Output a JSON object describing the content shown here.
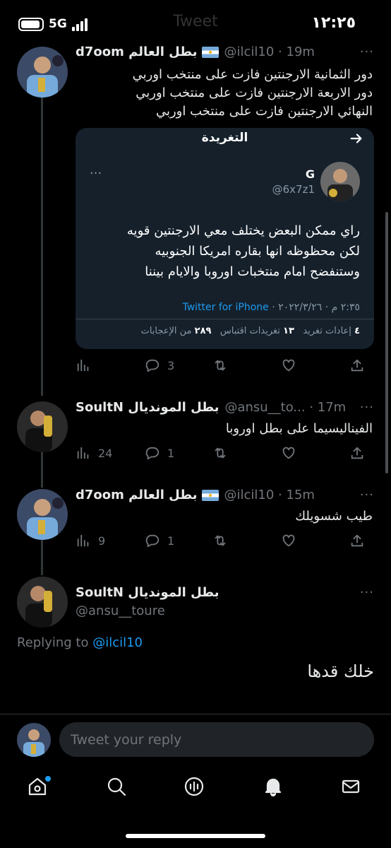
{
  "status_bar": {
    "time": "١٢:٢٥",
    "network": "5G",
    "ghost_title": "Tweet"
  },
  "tweets": [
    {
      "name": "d7oom بطل العالم",
      "handle": "@ilcil10 · 19m",
      "lines": [
        "دور الثمانية الارجنتين فازت على منتخب اوربي",
        "دور الاربعة الارجنتين فازت على منتخب اوربي",
        "النهائي الارجنتين فازت على منتخب اوربي"
      ],
      "quote": {
        "title": "التغريدة",
        "name": "G",
        "handle": "@6x7z1",
        "lines": [
          "راي ممكن البعض يختلف معي الارجنتين قويه",
          "لكن محظوظه انها بقاره امريكا الجنوبيه",
          "وستنفضح امام منتخبات اوروبا والايام بيننا"
        ],
        "date": "٢:٣٥ م · ٢٠٢٢/٣/٢٦ · ",
        "source": "Twitter for iPhone",
        "stats": {
          "retweets_count": "٤",
          "retweets_label": "إعادات تغريد",
          "quotes_count": "١٣",
          "quotes_label": "تغريدات اقتباس",
          "likes_count": "٢٨٩",
          "likes_label": "من الإعجابات"
        }
      },
      "views": "",
      "replies": "3"
    },
    {
      "name": "SoultN بطل المونديال",
      "handle": "@ansu__to... · 17m",
      "lines": [
        "الفيناليسيما على بطل اوروبا"
      ],
      "views": "24",
      "replies": "1"
    },
    {
      "name": "d7oom بطل العالم",
      "handle": "@ilcil10 · 15m",
      "lines": [
        "طيب شسويلك"
      ],
      "views": "9",
      "replies": "1"
    }
  ],
  "focused": {
    "name": "SoultN بطل المونديال",
    "handle": "@ansu__toure",
    "replying_prefix": "Replying to ",
    "replying_to": "@ilcil10",
    "text": "خلك قدها"
  },
  "reply": {
    "placeholder": "Tweet your reply"
  },
  "icons": {
    "more": "more-icon",
    "views": "views-icon",
    "reply": "reply-icon",
    "retweet": "retweet-icon",
    "like": "like-icon",
    "share": "share-icon"
  },
  "colors": {
    "accent": "#1d9bf0",
    "background": "#000000",
    "card": "#15202b",
    "muted": "#71767b"
  }
}
